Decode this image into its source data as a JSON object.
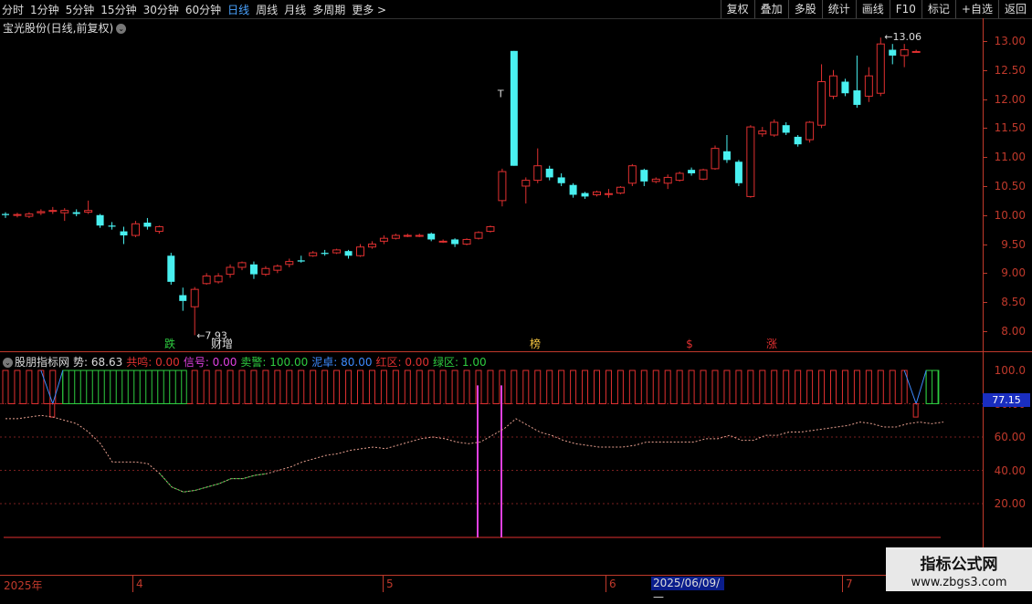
{
  "toolbar": {
    "periods": [
      "分时",
      "1分钟",
      "5分钟",
      "15分钟",
      "30分钟",
      "60分钟",
      "日线",
      "周线",
      "月线",
      "多周期",
      "更多 >"
    ],
    "active_period": "日线",
    "right": [
      "复权",
      "叠加",
      "多股",
      "统计",
      "画线",
      "F10",
      "标记",
      "+自选",
      "返回"
    ]
  },
  "stock_title": "宝光股份(日线,前复权)",
  "price_axis": [
    "13.00",
    "12.50",
    "12.00",
    "11.50",
    "11.00",
    "10.50",
    "10.00",
    "9.50",
    "9.00",
    "8.50",
    "8.00"
  ],
  "hi_label": "13.06",
  "lo_label": "7.93",
  "marks": [
    "跌",
    "财增",
    "榜",
    "$",
    "涨"
  ],
  "marks_colors": [
    "#2ecc40",
    "#dddddd",
    "#f5c542",
    "#e03030",
    "#e03030"
  ],
  "T_label": "T",
  "indicator": {
    "name": "股朋指标网",
    "items": [
      {
        "label": "势: 68.63",
        "color": "#dddddd"
      },
      {
        "label": "共鸣: 0.00",
        "color": "#e03030"
      },
      {
        "label": "信号: 0.00",
        "color": "#e040e0"
      },
      {
        "label": "卖警: 100.00",
        "color": "#2ecc40"
      },
      {
        "label": "泥卓: 80.00",
        "color": "#3d8bff"
      },
      {
        "label": "红区: 0.00",
        "color": "#e03030"
      },
      {
        "label": "绿区: 1.00",
        "color": "#2ecc40"
      }
    ]
  },
  "ind_axis": [
    "100.0",
    "80.00",
    "60.00",
    "40.00",
    "20.00"
  ],
  "current_value": "77.15",
  "dates": {
    "start": "2025年",
    "months": [
      "4",
      "5",
      "6",
      "7"
    ],
    "cursor": "2025/06/09/—"
  },
  "watermark": {
    "line1": "指标公式网",
    "line2": "www.zbgs3.com"
  },
  "colors": {
    "up": "#e03030",
    "down": "#49f0f0",
    "axis": "#c0392b"
  },
  "chart_data": {
    "type": "candlestick",
    "ylim": [
      7.8,
      13.2
    ],
    "candles": [
      [
        10.02,
        10.0,
        9.95,
        10.05
      ],
      [
        10.0,
        10.01,
        9.96,
        10.04
      ],
      [
        9.98,
        10.02,
        9.95,
        10.05
      ],
      [
        10.04,
        10.06,
        10.0,
        10.1
      ],
      [
        10.07,
        10.08,
        10.02,
        10.14
      ],
      [
        10.04,
        10.08,
        9.9,
        10.12
      ],
      [
        10.05,
        10.02,
        9.98,
        10.1
      ],
      [
        10.05,
        10.08,
        10.02,
        10.25
      ],
      [
        10.0,
        9.82,
        9.78,
        10.02
      ],
      [
        9.82,
        9.8,
        9.75,
        9.88
      ],
      [
        9.72,
        9.65,
        9.5,
        9.8
      ],
      [
        9.65,
        9.85,
        9.62,
        9.9
      ],
      [
        9.87,
        9.8,
        9.75,
        9.95
      ],
      [
        9.72,
        9.8,
        9.68,
        9.82
      ],
      [
        9.3,
        8.85,
        8.8,
        9.35
      ],
      [
        8.62,
        8.52,
        8.35,
        8.75
      ],
      [
        8.42,
        8.72,
        7.93,
        8.76
      ],
      [
        8.82,
        8.95,
        8.8,
        9.0
      ],
      [
        8.85,
        8.95,
        8.82,
        9.0
      ],
      [
        8.98,
        9.1,
        8.92,
        9.15
      ],
      [
        9.1,
        9.18,
        9.05,
        9.2
      ],
      [
        9.15,
        8.98,
        8.9,
        9.2
      ],
      [
        8.98,
        9.08,
        8.95,
        9.12
      ],
      [
        9.05,
        9.12,
        9.0,
        9.15
      ],
      [
        9.15,
        9.2,
        9.1,
        9.25
      ],
      [
        9.22,
        9.2,
        9.18,
        9.3
      ],
      [
        9.3,
        9.35,
        9.28,
        9.38
      ],
      [
        9.35,
        9.33,
        9.3,
        9.4
      ],
      [
        9.35,
        9.4,
        9.33,
        9.42
      ],
      [
        9.38,
        9.3,
        9.25,
        9.4
      ],
      [
        9.3,
        9.45,
        9.28,
        9.5
      ],
      [
        9.45,
        9.5,
        9.42,
        9.55
      ],
      [
        9.55,
        9.6,
        9.5,
        9.65
      ],
      [
        9.6,
        9.65,
        9.58,
        9.68
      ],
      [
        9.65,
        9.65,
        9.62,
        9.68
      ],
      [
        9.65,
        9.65,
        9.62,
        9.68
      ],
      [
        9.68,
        9.58,
        9.55,
        9.7
      ],
      [
        9.55,
        9.55,
        9.52,
        9.58
      ],
      [
        9.58,
        9.5,
        9.45,
        9.6
      ],
      [
        9.5,
        9.58,
        9.48,
        9.6
      ],
      [
        9.6,
        9.7,
        9.58,
        9.72
      ],
      [
        9.72,
        9.8,
        9.7,
        9.82
      ],
      [
        10.25,
        10.75,
        10.15,
        10.8
      ],
      [
        12.83,
        10.85,
        10.85,
        12.83
      ],
      [
        10.5,
        10.6,
        10.2,
        10.65
      ],
      [
        10.6,
        10.85,
        10.55,
        11.15
      ],
      [
        10.8,
        10.65,
        10.6,
        10.85
      ],
      [
        10.65,
        10.55,
        10.5,
        10.72
      ],
      [
        10.52,
        10.35,
        10.3,
        10.55
      ],
      [
        10.38,
        10.32,
        10.28,
        10.4
      ],
      [
        10.35,
        10.4,
        10.32,
        10.42
      ],
      [
        10.37,
        10.37,
        10.3,
        10.45
      ],
      [
        10.38,
        10.48,
        10.36,
        10.5
      ],
      [
        10.55,
        10.85,
        10.5,
        10.88
      ],
      [
        10.78,
        10.58,
        10.5,
        10.8
      ],
      [
        10.58,
        10.62,
        10.55,
        10.65
      ],
      [
        10.55,
        10.65,
        10.45,
        10.7
      ],
      [
        10.6,
        10.72,
        10.58,
        10.75
      ],
      [
        10.78,
        10.72,
        10.68,
        10.82
      ],
      [
        10.62,
        10.78,
        10.6,
        10.8
      ],
      [
        10.8,
        11.15,
        10.78,
        11.2
      ],
      [
        11.1,
        10.95,
        10.9,
        11.38
      ],
      [
        10.92,
        10.55,
        10.5,
        10.95
      ],
      [
        10.32,
        11.52,
        10.3,
        11.55
      ],
      [
        11.4,
        11.45,
        11.35,
        11.52
      ],
      [
        11.38,
        11.6,
        11.35,
        11.65
      ],
      [
        11.55,
        11.42,
        11.38,
        11.6
      ],
      [
        11.35,
        11.22,
        11.18,
        11.38
      ],
      [
        11.3,
        11.6,
        11.25,
        11.62
      ],
      [
        11.55,
        12.3,
        11.5,
        12.6
      ],
      [
        12.05,
        12.4,
        12.0,
        12.5
      ],
      [
        12.3,
        12.1,
        12.05,
        12.35
      ],
      [
        12.15,
        11.9,
        11.85,
        12.75
      ],
      [
        12.05,
        12.4,
        11.95,
        12.55
      ],
      [
        12.1,
        12.95,
        12.05,
        13.06
      ],
      [
        12.85,
        12.75,
        12.6,
        12.95
      ],
      [
        12.75,
        12.85,
        12.55,
        12.95
      ],
      [
        12.82,
        12.82,
        12.8,
        12.85
      ]
    ]
  }
}
